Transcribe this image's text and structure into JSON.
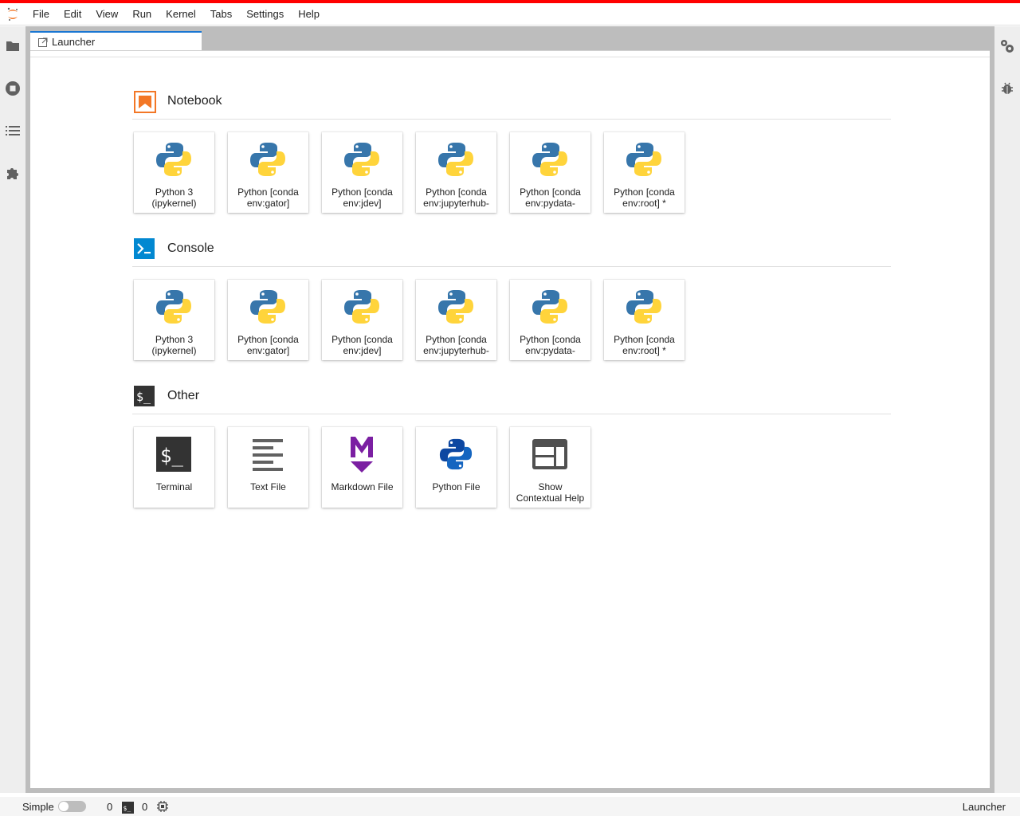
{
  "menubar": {
    "items": [
      "File",
      "Edit",
      "View",
      "Run",
      "Kernel",
      "Tabs",
      "Settings",
      "Help"
    ]
  },
  "tabs": [
    {
      "label": "Launcher"
    }
  ],
  "sections": [
    {
      "title": "Notebook",
      "icon": "notebook-icon",
      "cards": [
        {
          "label": "Python 3\n(ipykernel)",
          "icon": "python-logo-icon"
        },
        {
          "label": "Python [conda\nenv:gator]",
          "icon": "python-logo-icon"
        },
        {
          "label": "Python [conda\nenv:jdev]",
          "icon": "python-logo-icon"
        },
        {
          "label": "Python [conda\nenv:jupyterhub-",
          "icon": "python-logo-icon"
        },
        {
          "label": "Python [conda\nenv:pydata-",
          "icon": "python-logo-icon"
        },
        {
          "label": "Python [conda\nenv:root] *",
          "icon": "python-logo-icon"
        }
      ]
    },
    {
      "title": "Console",
      "icon": "console-icon",
      "cards": [
        {
          "label": "Python 3\n(ipykernel)",
          "icon": "python-logo-icon"
        },
        {
          "label": "Python [conda\nenv:gator]",
          "icon": "python-logo-icon"
        },
        {
          "label": "Python [conda\nenv:jdev]",
          "icon": "python-logo-icon"
        },
        {
          "label": "Python [conda\nenv:jupyterhub-",
          "icon": "python-logo-icon"
        },
        {
          "label": "Python [conda\nenv:pydata-",
          "icon": "python-logo-icon"
        },
        {
          "label": "Python [conda\nenv:root] *",
          "icon": "python-logo-icon"
        }
      ]
    },
    {
      "title": "Other",
      "icon": "terminal-icon",
      "cards": [
        {
          "label": "Terminal",
          "icon": "terminal-icon"
        },
        {
          "label": "Text File",
          "icon": "text-file-icon"
        },
        {
          "label": "Markdown File",
          "icon": "markdown-icon"
        },
        {
          "label": "Python File",
          "icon": "python-file-icon"
        },
        {
          "label": "Show\nContextual Help",
          "icon": "contextual-help-icon"
        }
      ]
    }
  ],
  "statusbar": {
    "mode_label": "Simple",
    "kernel_count": "0",
    "terminal_count": "0",
    "right_label": "Launcher"
  },
  "colors": {
    "accent": "#ff0000",
    "tab_active": "#1976d2",
    "notebook_orange": "#f37726",
    "console_blue": "#0288d1",
    "markdown_purple": "#7b1fa2"
  }
}
